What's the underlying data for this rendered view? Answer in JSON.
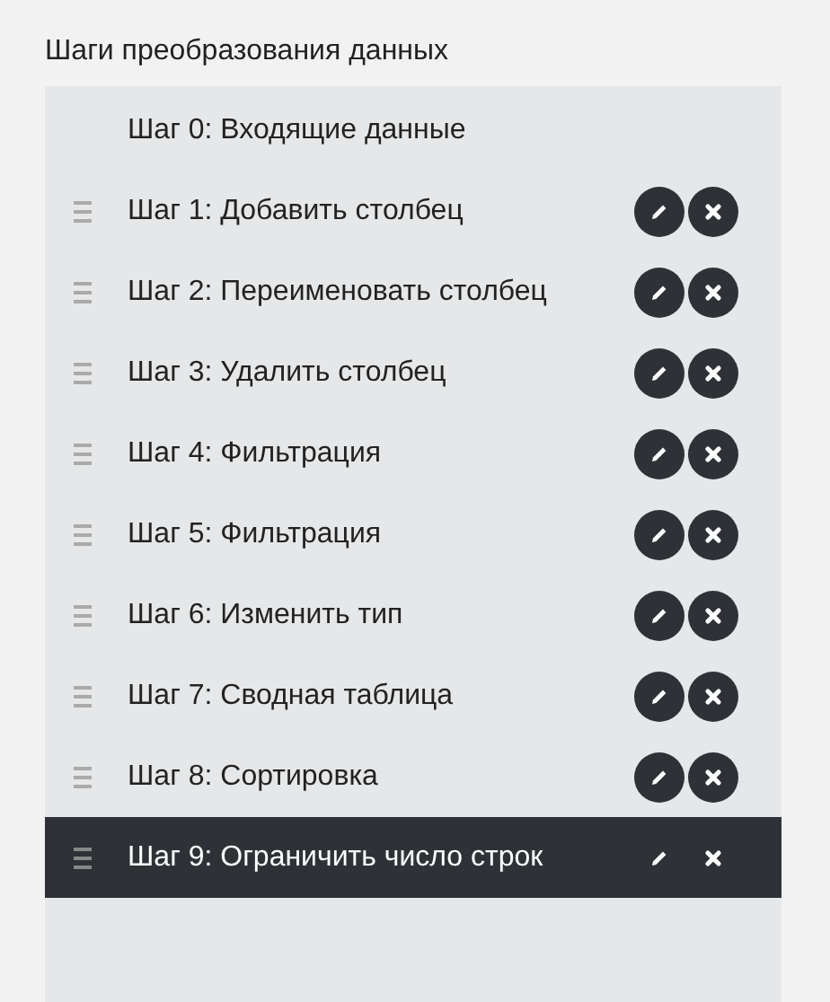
{
  "title": "Шаги преобразования данных",
  "steps": [
    {
      "label": "Шаг 0: Входящие данные",
      "kind": "source",
      "selected": false
    },
    {
      "label": "Шаг 1: Добавить столбец",
      "kind": "step",
      "selected": false
    },
    {
      "label": "Шаг 2: Переименовать столбец",
      "kind": "step",
      "selected": false
    },
    {
      "label": "Шаг 3: Удалить столбец",
      "kind": "step",
      "selected": false
    },
    {
      "label": "Шаг 4: Фильтрация",
      "kind": "step",
      "selected": false
    },
    {
      "label": "Шаг 5: Фильтрация",
      "kind": "step",
      "selected": false
    },
    {
      "label": "Шаг 6: Изменить тип",
      "kind": "step",
      "selected": false
    },
    {
      "label": "Шаг 7: Сводная таблица",
      "kind": "step",
      "selected": false
    },
    {
      "label": "Шаг 8: Сортировка",
      "kind": "step",
      "selected": false
    },
    {
      "label": "Шаг 9: Ограничить число строк",
      "kind": "step",
      "selected": true
    }
  ]
}
